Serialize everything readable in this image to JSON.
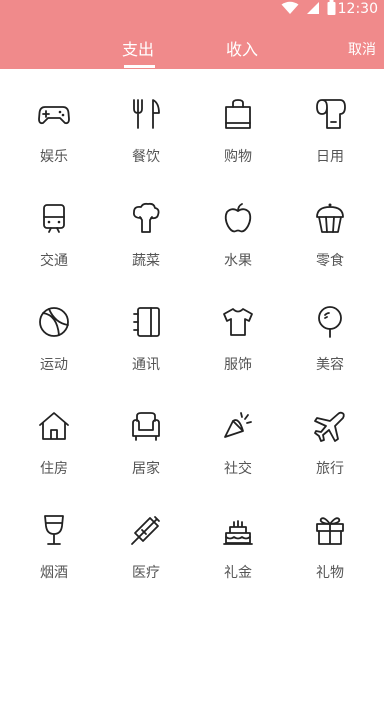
{
  "status": {
    "time": "12:30"
  },
  "tabs": {
    "expense": "支出",
    "income": "收入",
    "active": "expense"
  },
  "cancel_label": "取消",
  "categories": [
    {
      "label": "娱乐",
      "icon": "gamepad-icon"
    },
    {
      "label": "餐饮",
      "icon": "fork-knife-icon"
    },
    {
      "label": "购物",
      "icon": "shopping-bag-icon"
    },
    {
      "label": "日用",
      "icon": "tissue-roll-icon"
    },
    {
      "label": "交通",
      "icon": "train-icon"
    },
    {
      "label": "蔬菜",
      "icon": "broccoli-icon"
    },
    {
      "label": "水果",
      "icon": "apple-icon"
    },
    {
      "label": "零食",
      "icon": "cupcake-icon"
    },
    {
      "label": "运动",
      "icon": "ball-icon"
    },
    {
      "label": "通讯",
      "icon": "phonebook-icon"
    },
    {
      "label": "服饰",
      "icon": "tshirt-icon"
    },
    {
      "label": "美容",
      "icon": "mirror-icon"
    },
    {
      "label": "住房",
      "icon": "house-icon"
    },
    {
      "label": "居家",
      "icon": "sofa-icon"
    },
    {
      "label": "社交",
      "icon": "party-popper-icon"
    },
    {
      "label": "旅行",
      "icon": "airplane-icon"
    },
    {
      "label": "烟酒",
      "icon": "wine-glass-icon"
    },
    {
      "label": "医疗",
      "icon": "syringe-icon"
    },
    {
      "label": "礼金",
      "icon": "cake-icon"
    },
    {
      "label": "礼物",
      "icon": "gift-icon"
    }
  ]
}
